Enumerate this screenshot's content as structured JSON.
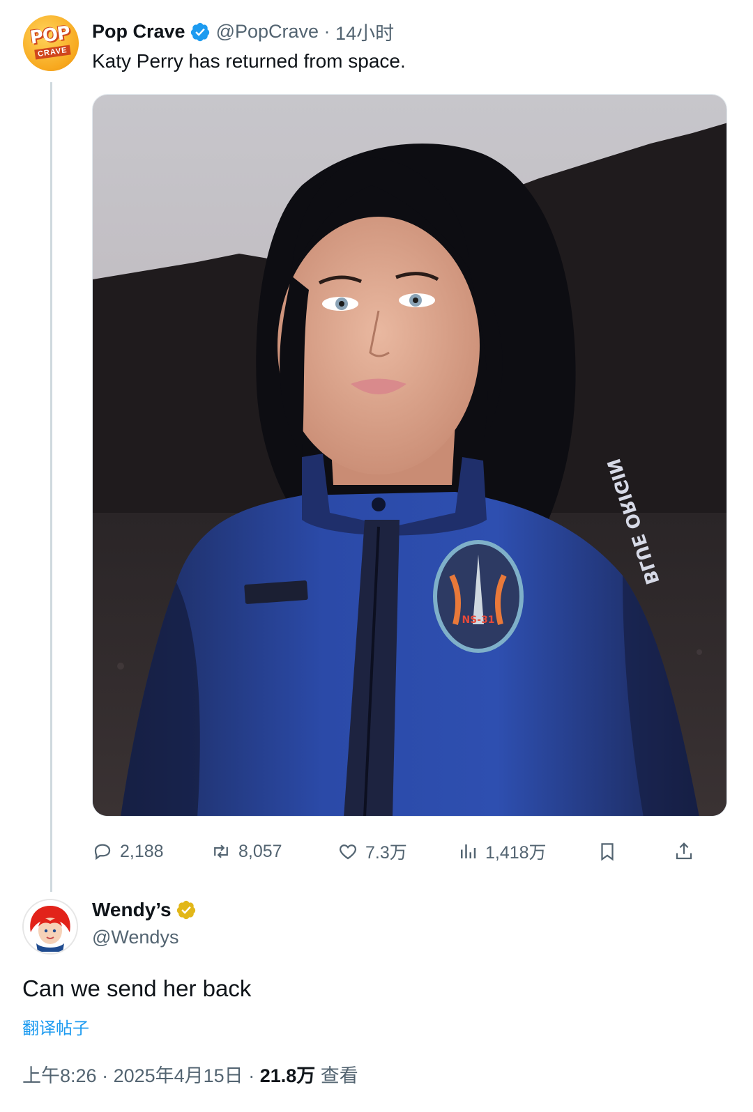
{
  "tweet": {
    "author_name": "Pop Crave",
    "handle": "@PopCrave",
    "time": "14小时",
    "text": "Katy Perry has returned from space.",
    "avatar_text_top": "POP",
    "avatar_text_bottom": "CRAVE",
    "patch_text": "NS-31",
    "sleeve_text": "BLUE ORIGIN",
    "actions": {
      "replies": "2,188",
      "retweets": "8,057",
      "likes": "7.3万",
      "views": "1,418万"
    }
  },
  "reply": {
    "author_name": "Wendy’s",
    "handle": "@Wendys",
    "text": "Can we send her back",
    "translate_label": "翻译帖子",
    "time": "上午8:26",
    "date": "2025年4月15日",
    "views_count": "21.8万",
    "views_label": "查看"
  },
  "colors": {
    "verified_blue": "#1d9bf0",
    "verified_gold": "#e2b719",
    "link": "#1d9bf0"
  },
  "icons": [
    "reply-icon",
    "retweet-icon",
    "like-icon",
    "views-icon",
    "bookmark-icon",
    "share-icon",
    "verified-badge-icon"
  ]
}
